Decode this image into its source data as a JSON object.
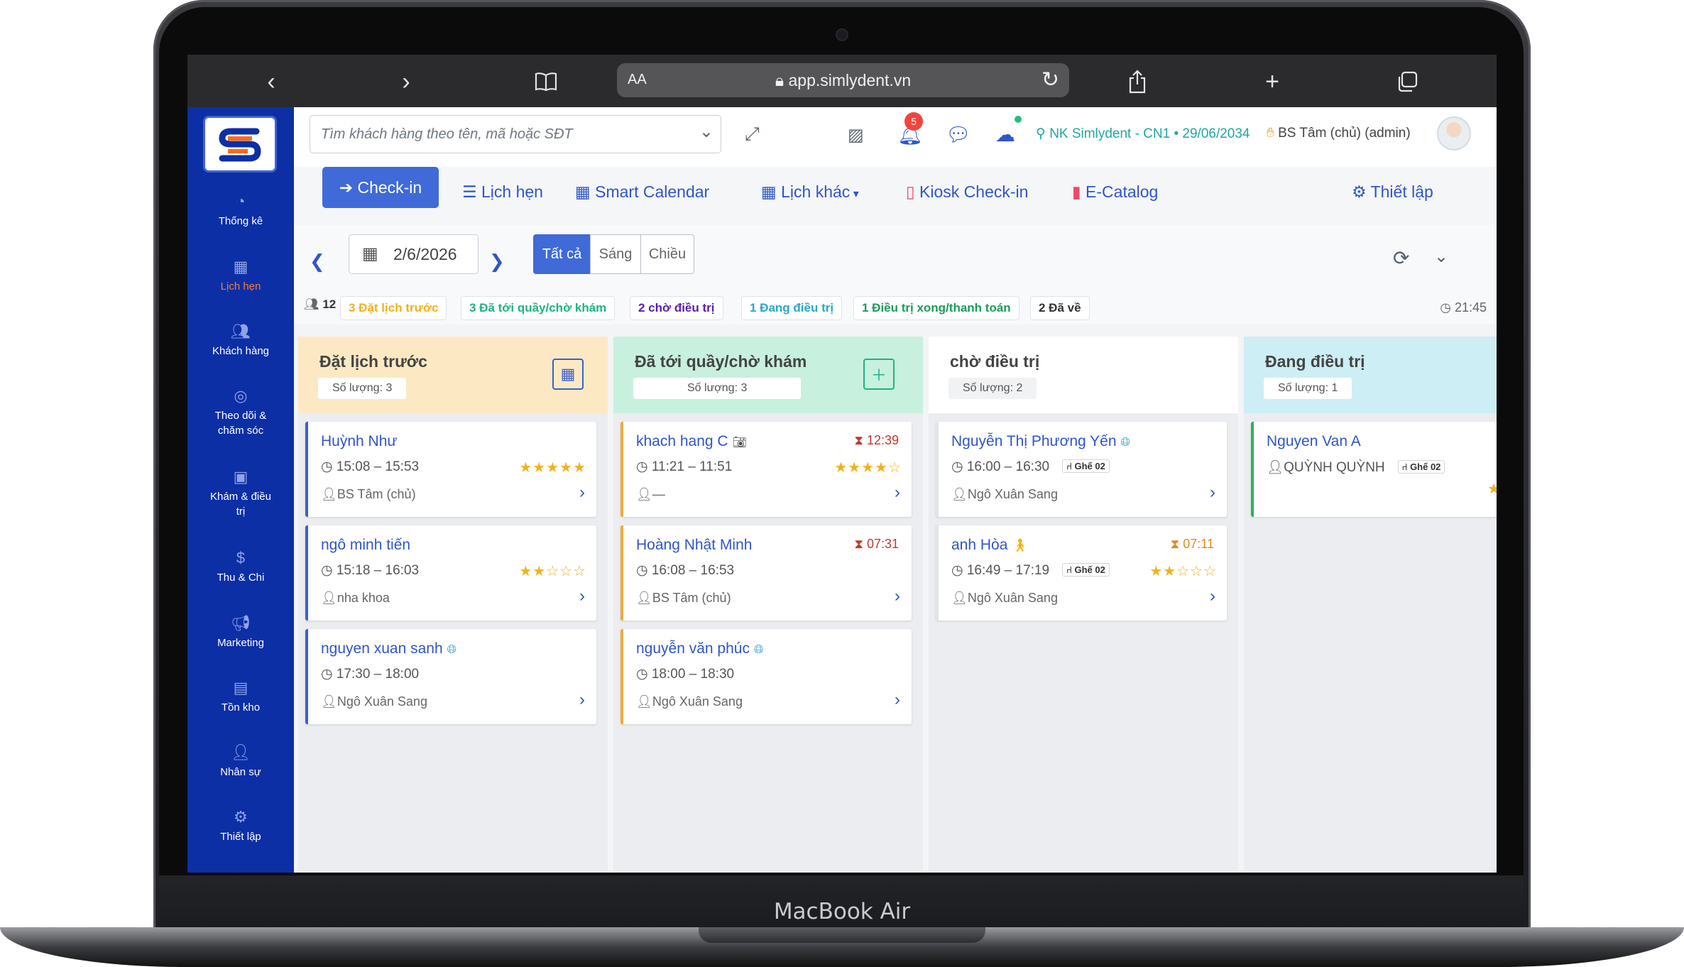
{
  "device_label": "MacBook Air",
  "browser": {
    "aa": "AA",
    "url": "app.simlydent.vn"
  },
  "sidebar": {
    "items": [
      {
        "label": "Thống kê",
        "icon": "gauge-icon"
      },
      {
        "label": "Lịch hẹn",
        "icon": "calendar-icon",
        "active": true
      },
      {
        "label": "Khách hàng",
        "icon": "users-icon"
      },
      {
        "label": "Theo dõi & chăm sóc",
        "icon": "target-icon"
      },
      {
        "label": "Khám & điều trị",
        "icon": "clipboard-icon"
      },
      {
        "label": "Thu & Chi",
        "icon": "dollar-icon"
      },
      {
        "label": "Marketing",
        "icon": "megaphone-icon"
      },
      {
        "label": "Tồn kho",
        "icon": "boxes-icon"
      },
      {
        "label": "Nhân sự",
        "icon": "staff-icon"
      },
      {
        "label": "Thiết lập",
        "icon": "user-cog-icon"
      }
    ]
  },
  "topbar": {
    "search_placeholder": "Tìm khách hàng theo tên, mã hoặc SĐT",
    "notifications": "5",
    "branch": "NK Simlydent - CN1 • 29/06/2034",
    "user": "BS Tâm (chủ) (admin)"
  },
  "tabs": {
    "checkin": "Check-in",
    "lich_hen": "Lịch hẹn",
    "smart_calendar": "Smart Calendar",
    "lich_khac": "Lịch khác",
    "kiosk": "Kiosk Check-in",
    "ecatalog": "E-Catalog",
    "thiet_lap": "Thiết lập"
  },
  "filter": {
    "date": "2/6/2026",
    "segments": [
      "Tất cả",
      "Sáng",
      "Chiều"
    ],
    "selected_segment": "Tất cả",
    "total": "12",
    "time": "21:45"
  },
  "status_chips": [
    {
      "label": "3 Đặt lịch trước",
      "color": "#f2b21c"
    },
    {
      "label": "3 Đã tới quầy/chờ khám",
      "color": "#1fb385"
    },
    {
      "label": "2 chờ điều trị",
      "color": "#5a1fb0"
    },
    {
      "label": "1 Đang điều trị",
      "color": "#2aa7c8"
    },
    {
      "label": "1 Điều trị xong/thanh toán",
      "color": "#1b9c5a"
    },
    {
      "label": "2 Đã về",
      "color": "#333333"
    }
  ],
  "columns": [
    {
      "title": "Đặt lịch trước",
      "qty": "Số lượng: 3",
      "head_color": "#fce9c4",
      "accent": "#3a5fcf",
      "cards": [
        {
          "name": "Huỳnh Như",
          "time": "15:08 – 15:53",
          "doctor": "BS Tâm (chủ)",
          "stars": "★★★★★"
        },
        {
          "name": "ngô minh tiến",
          "time": "15:18 – 16:03",
          "doctor": "nha khoa",
          "stars": "★★☆☆☆"
        },
        {
          "name": "nguyen xuan sanh",
          "time": "17:30 – 18:00",
          "doctor": "Ngô Xuân Sang",
          "globe": true
        }
      ]
    },
    {
      "title": "Đã tới quầy/chờ khám",
      "qty": "Số lượng: 3",
      "head_color": "#c8f0df",
      "accent": "#f2a93b",
      "cards": [
        {
          "name": "khach hang C",
          "time": "11:21 – 11:51",
          "doctor": "—",
          "stars": "★★★★☆",
          "timer": "12:39",
          "camera": true
        },
        {
          "name": "Hoàng Nhật Minh",
          "time": "16:08 – 16:53",
          "doctor": "BS Tâm (chủ)",
          "timer": "07:31"
        },
        {
          "name": "nguyễn văn phúc",
          "time": "18:00 – 18:30",
          "doctor": "Ngô Xuân Sang",
          "globe": true
        }
      ]
    },
    {
      "title": "chờ điều trị",
      "qty": "Số lượng: 2",
      "head_color": "#ffffff",
      "accent": "#cfd4da",
      "cards": [
        {
          "name": "Nguyễn Thị Phương Yến",
          "time": "16:00 – 16:30",
          "seat": "Ghế 02",
          "doctor": "Ngô Xuân Sang",
          "globe": true
        },
        {
          "name": "anh Hòa",
          "time": "16:49 – 17:19",
          "seat": "Ghế 02",
          "doctor": "Ngô Xuân Sang",
          "stars": "★★☆☆☆",
          "timer": "07:11",
          "walk": true
        }
      ]
    },
    {
      "title": "Đang điều trị",
      "qty": "Số lượng: 1",
      "head_color": "#cdeef4",
      "accent": "#2bb35c",
      "cards": [
        {
          "name": "Nguyen Van A",
          "time": "",
          "doctor": "QUỲNH QUỲNH",
          "seat": "Ghế 02",
          "stars": "★"
        }
      ]
    }
  ]
}
